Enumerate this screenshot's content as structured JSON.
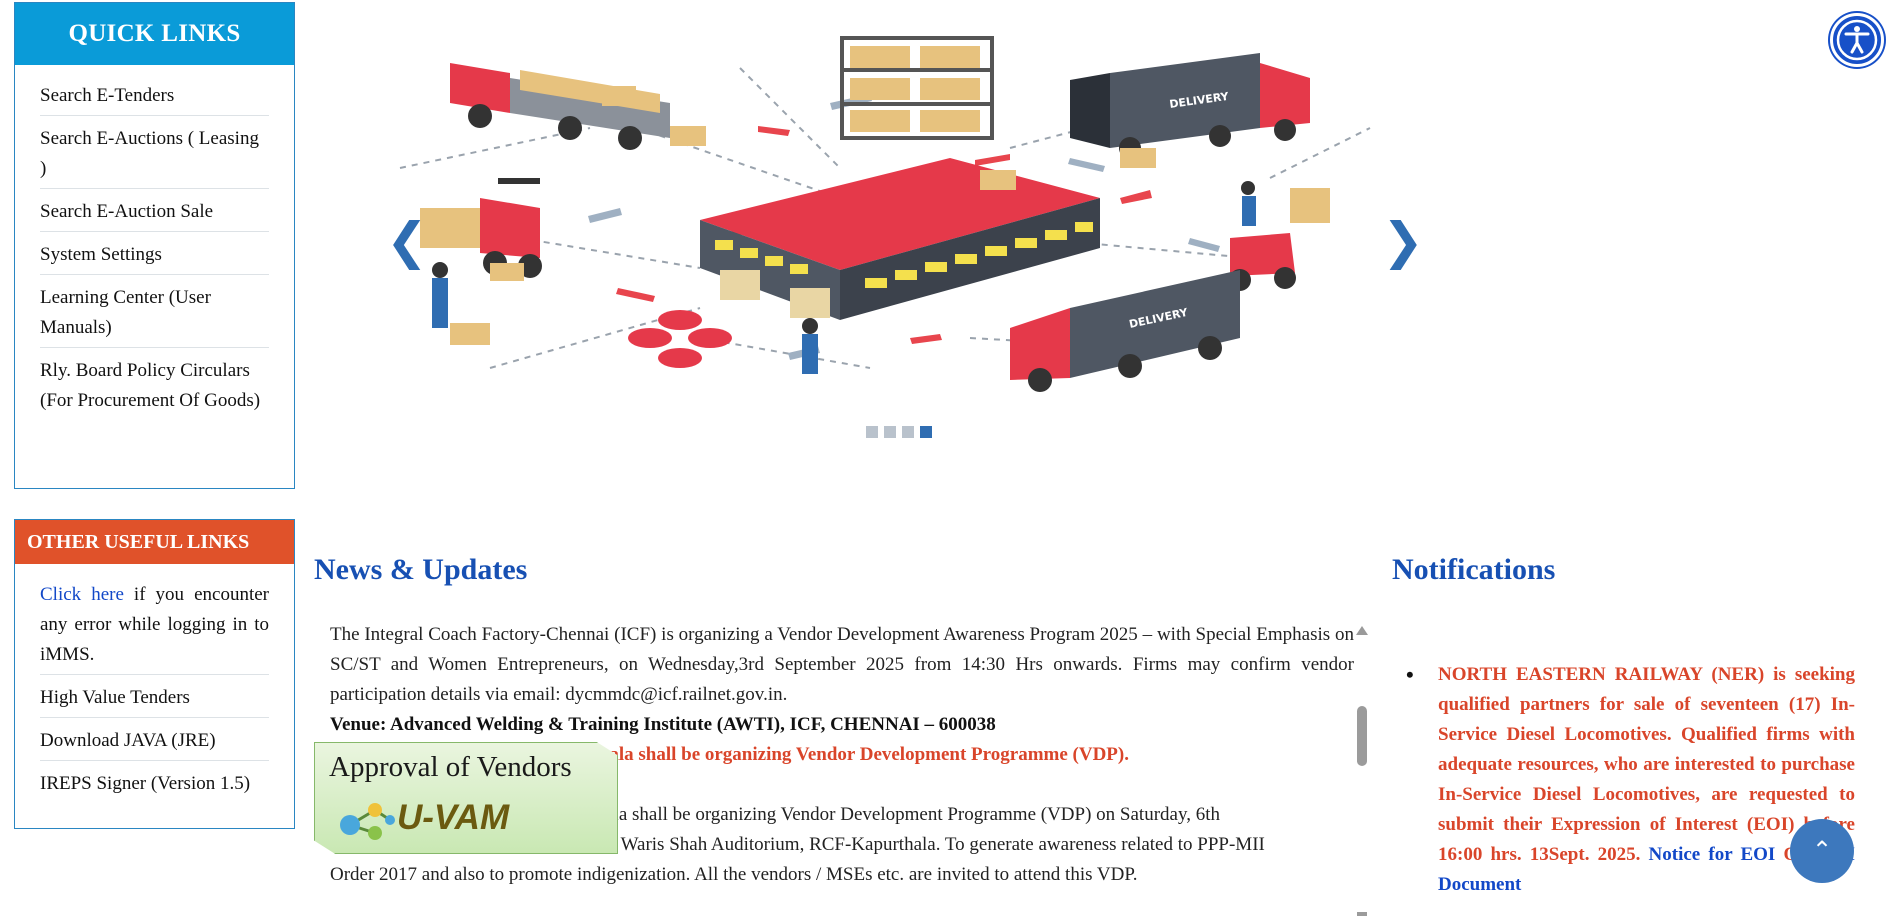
{
  "quick_links": {
    "title": "QUICK LINKS",
    "items": [
      {
        "label": "Search E-Tenders"
      },
      {
        "label": "Search E-Auctions ( Leasing )"
      },
      {
        "label": "Search E-Auction Sale"
      },
      {
        "label": "System Settings"
      },
      {
        "label": "Learning Center (User Manuals)"
      },
      {
        "label": "Rly. Board Policy Circulars (For Procurement Of Goods)"
      }
    ]
  },
  "other_links": {
    "title": "OTHER USEFUL LINKS",
    "click_here": "Click here",
    "click_here_rest": " if you encounter any error while logging in to iMMS.",
    "items": [
      {
        "label": "High Value Tenders"
      },
      {
        "label": "Download JAVA (JRE)"
      },
      {
        "label": "IREPS Signer (Version 1.5)"
      }
    ]
  },
  "carousel": {
    "slide_count": 4,
    "active_slide": 4,
    "prev_glyph": "❮",
    "next_glyph": "❯",
    "slide_texts": [
      "DELIVERY",
      "DELIVERY"
    ]
  },
  "news": {
    "title": "News & Updates",
    "para1": "The Integral Coach Factory-Chennai (ICF) is organizing a Vendor Development Awareness Program 2025 – with Special Emphasis on SC/ST and Women Entrepreneurs, on Wednesday,3rd September 2025 from 14:30 Hrs onwards. Firms may confirm vendor participation details via email: dycmmdc@icf.railnet.gov.in.",
    "venue": "Venue: Advanced Welding & Training Institute (AWTI), ICF, CHENNAI – 600038",
    "red_headline": "rthala shall be organizing Vendor Development Programme (VDP).",
    "para2_line1": "rthala shall be organizing Vendor Development Programme (VDP) on Saturday, 6th",
    "para2_line2": "ls in Waris Shah Auditorium, RCF-Kapurthala. To generate awareness related to PPP-MII",
    "para2_line3": "Order 2017 and also to promote indigenization. All the vendors / MSEs etc. are invited to attend this VDP."
  },
  "uvam": {
    "title": "Approval of Vendors",
    "brand": "U-VAM"
  },
  "notifications": {
    "title": "Notifications",
    "item_text": "NORTH EASTERN RAILWAY (NER) is seeking qualified partners for sale of seventeen (17) In-Service Diesel Locomotives. Qualified firms with adequate resources, who are interested to purchase In-Service Diesel Locomotives, are requested to submit their Expression of Interest (EOI) before 16:00 hrs. 13Sept. 2025. ",
    "link1": "Notice for EOI",
    "sep": " OR ",
    "link2": "EOI Document"
  },
  "buttons": {
    "scroll_top_glyph": "⌃"
  },
  "colors": {
    "quick_links_header": "#0a9bd8",
    "other_links_header": "#e0522a",
    "heading_blue": "#1750b3",
    "alert_red": "#d9452a",
    "link_blue": "#1248c8"
  }
}
